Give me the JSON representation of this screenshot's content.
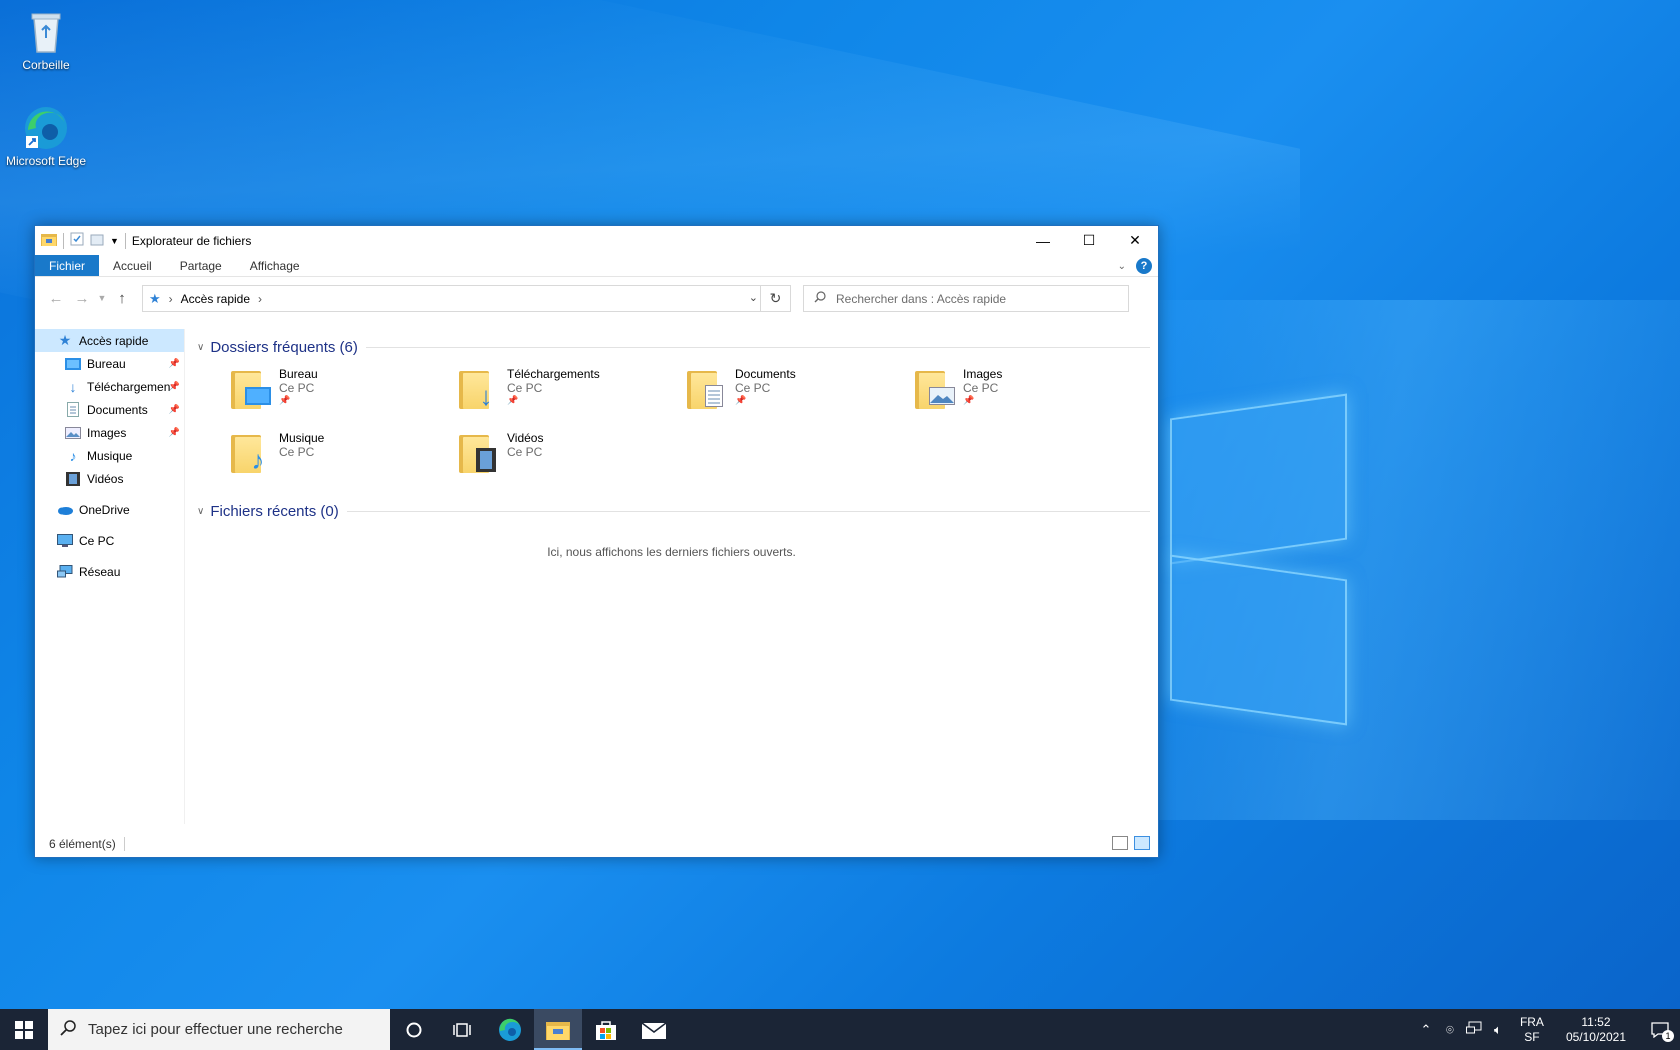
{
  "desktop": {
    "icons": [
      {
        "label": "Corbeille",
        "icon": "recycle-bin-icon"
      },
      {
        "label": "Microsoft Edge",
        "icon": "edge-icon"
      }
    ]
  },
  "window": {
    "title": "Explorateur de fichiers",
    "ribbon_tabs": [
      "Fichier",
      "Accueil",
      "Partage",
      "Affichage"
    ],
    "help": "?",
    "controls": {
      "minimize": "—",
      "maximize": "☐",
      "close": "✕"
    },
    "address": {
      "location": "Accès rapide"
    },
    "search_placeholder": "Rechercher dans : Accès rapide",
    "sidebar": {
      "quick_access": "Accès rapide",
      "pinned": [
        {
          "label": "Bureau",
          "pinned": true
        },
        {
          "label": "Téléchargements",
          "pinned": true
        },
        {
          "label": "Documents",
          "pinned": true
        },
        {
          "label": "Images",
          "pinned": true
        },
        {
          "label": "Musique",
          "pinned": false
        },
        {
          "label": "Vidéos",
          "pinned": false
        }
      ],
      "roots": [
        "OneDrive",
        "Ce PC",
        "Réseau"
      ]
    },
    "frequent": {
      "header": "Dossiers fréquents (6)",
      "items": [
        {
          "name": "Bureau",
          "location": "Ce PC",
          "pinned": true
        },
        {
          "name": "Téléchargements",
          "location": "Ce PC",
          "pinned": true
        },
        {
          "name": "Documents",
          "location": "Ce PC",
          "pinned": true
        },
        {
          "name": "Images",
          "location": "Ce PC",
          "pinned": true
        },
        {
          "name": "Musique",
          "location": "Ce PC",
          "pinned": false
        },
        {
          "name": "Vidéos",
          "location": "Ce PC",
          "pinned": false
        }
      ]
    },
    "recent": {
      "header": "Fichiers récents (0)",
      "empty_text": "Ici, nous affichons les derniers fichiers ouverts."
    },
    "status": "6 élément(s)"
  },
  "taskbar": {
    "search_placeholder": "Tapez ici pour effectuer une recherche",
    "lang": {
      "line1": "FRA",
      "line2": "SF"
    },
    "clock": {
      "time": "11:52",
      "date": "05/10/2021"
    },
    "notifications": "1"
  },
  "colors": {
    "accent": "#1979ca",
    "taskbar": "#1b2536",
    "folder": "#f8d46b"
  }
}
